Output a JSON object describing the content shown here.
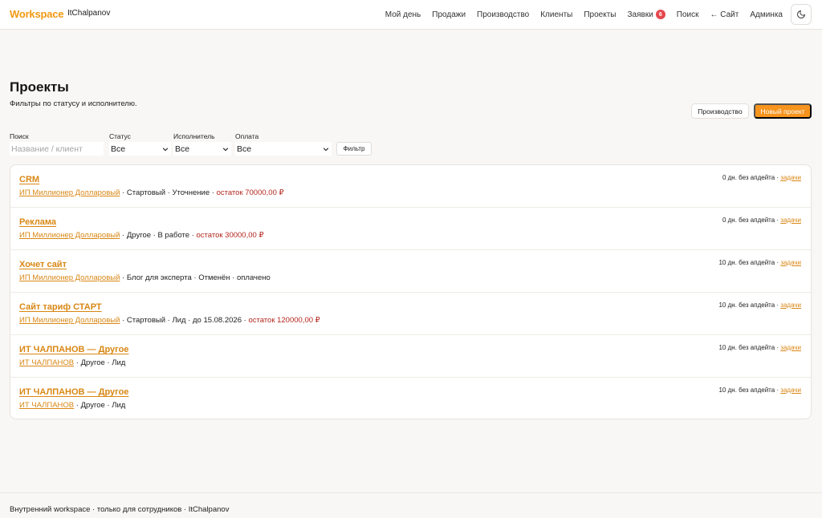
{
  "header": {
    "brand": "Workspace",
    "user": "ItChalpanov",
    "nav": [
      {
        "label": "Мой день"
      },
      {
        "label": "Продажи"
      },
      {
        "label": "Производство"
      },
      {
        "label": "Клиенты"
      },
      {
        "label": "Проекты"
      },
      {
        "label": "Заявки",
        "badge": "6"
      },
      {
        "label": "Поиск"
      },
      {
        "label": "← Сайт"
      },
      {
        "label": "Админка"
      }
    ],
    "theme_icon": "moon-icon"
  },
  "page": {
    "title": "Проекты",
    "subtitle": "Фильтры по статусу и исполнителю.",
    "production_button": "Производство",
    "new_project_button": "Новый проект"
  },
  "filters": {
    "search_label": "Поиск",
    "search_placeholder": "Название / клиент",
    "status_label": "Статус",
    "status_value": "Все",
    "executor_label": "Исполнитель",
    "executor_value": "Все",
    "payment_label": "Оплата",
    "payment_value": "Все",
    "submit_label": "Фильтр"
  },
  "projects": [
    {
      "title": "CRM",
      "client": "ИП Миллионер Долларовый",
      "meta": " · Стартовый · Уточнение · ",
      "debt": "остаток 70000,00 ₽",
      "updated": "0 дн. без апдейта · ",
      "tasks": "задачи"
    },
    {
      "title": "Реклама",
      "client": "ИП Миллионер Долларовый",
      "meta": " · Другое · В работе · ",
      "debt": "остаток 30000,00 ₽",
      "updated": "0 дн. без апдейта · ",
      "tasks": "задачи"
    },
    {
      "title": "Хочет сайт",
      "client": "ИП Миллионер Долларовый",
      "meta": " · Блог для эксперта · Отменён · оплачено",
      "debt": "",
      "updated": "10 дн. без апдейта · ",
      "tasks": "задачи"
    },
    {
      "title": "Сайт тариф СТАРТ",
      "client": "ИП Миллионер Долларовый",
      "meta": " · Стартовый · Лид · до 15.08.2026 · ",
      "debt": "остаток 120000,00 ₽",
      "updated": "10 дн. без апдейта · ",
      "tasks": "задачи"
    },
    {
      "title": "ИТ ЧАЛПАНОВ — Другое",
      "client": "ИТ ЧАЛПАНОВ",
      "meta": " · Другое · Лид",
      "debt": "",
      "updated": "10 дн. без апдейта · ",
      "tasks": "задачи"
    },
    {
      "title": "ИТ ЧАЛПАНОВ — Другое",
      "client": "ИТ ЧАЛПАНОВ",
      "meta": " · Другое · Лид",
      "debt": "",
      "updated": "10 дн. без апдейта · ",
      "tasks": "задачи"
    }
  ],
  "footer": {
    "text": "Внутренний workspace · только для сотрудников · ItChalpanov"
  }
}
